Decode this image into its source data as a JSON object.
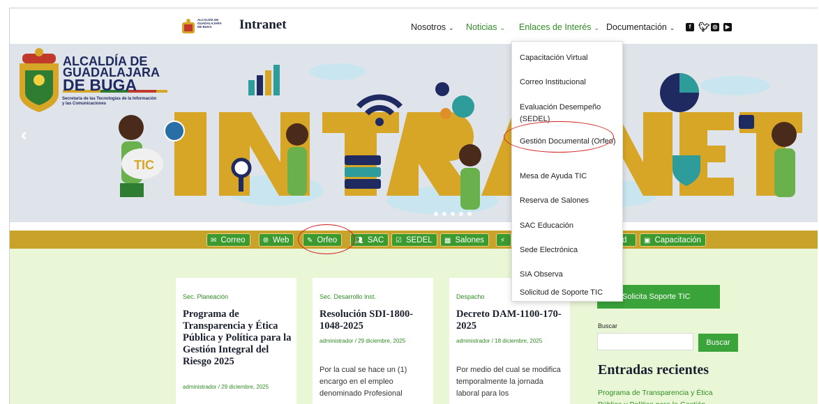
{
  "header": {
    "logo_text": "ALCALDÍA DE GUADALAJARA DE BUGA",
    "site_title": "Intranet",
    "nav": [
      {
        "label": "Nosotros",
        "chevron": "⌄"
      },
      {
        "label": "Noticias",
        "chevron": "⌄"
      },
      {
        "label": "Enlaces de Interés",
        "chevron": "⌄"
      },
      {
        "label": "Documentación",
        "chevron": "⌄"
      }
    ],
    "social_icons": [
      "facebook-icon",
      "twitter-icon",
      "instagram-icon",
      "youtube-icon"
    ],
    "colors": {
      "active_nav": "#2f8d23",
      "nav_text": "#222222"
    }
  },
  "hero": {
    "brand_line1": "ALCALDÍA DE",
    "brand_line2": "GUADALAJARA",
    "brand_line3": "DE BUGA",
    "brand_sub": "Secretaría de las Tecnologías de la Información y las Comunicaciones",
    "banner_word": "INTRANET",
    "sign_text": "TIC",
    "prev_arrow": "‹",
    "slider_dots": 5,
    "colors": {
      "letters": "#d8a627",
      "background": "#dfe4ea"
    }
  },
  "quick_links": [
    {
      "label": "Correo",
      "icon": "mail-icon"
    },
    {
      "label": "Web",
      "icon": "globe-icon"
    },
    {
      "label": "Orfeo",
      "icon": "document-edit-icon"
    },
    {
      "label": "SAC",
      "icon": "people-icon"
    },
    {
      "label": "SEDEL",
      "icon": "clipboard-check-icon"
    },
    {
      "label": "Salones",
      "icon": "building-icon"
    },
    {
      "label": "",
      "icon": "lightning-icon"
    },
    {
      "label": "d",
      "icon": ""
    },
    {
      "label": "Capacitación",
      "icon": "teacher-icon"
    }
  ],
  "dropdown": {
    "items": [
      "Capacitación Virtual",
      "Correo Institucional",
      "Evaluación Desempeño (SEDEL)",
      "Gestión Documental (Orfeo)",
      "Mesa de Ayuda TIC",
      "Reserva de Salones",
      "SAC Educación",
      "Sede Electrónica",
      "SIA Observa",
      "Solicitud de Soporte TIC"
    ]
  },
  "posts": [
    {
      "category": "Sec. Planeación",
      "title": "Programa de Transparencia y Ética Pública y Política para la Gestión Integral del Riesgo 2025",
      "meta": "administrador / 29 diciembre, 2025",
      "excerpt": ""
    },
    {
      "category": "Sec. Desarrollo Inst.",
      "title": "Resolución SDI-1800-1048-2025",
      "meta": "administrador / 29 diciembre, 2025",
      "excerpt": "Por la cual se hace un (1) encargo en el empleo denominado Profesional"
    },
    {
      "category": "Despacho",
      "title": "Decreto DAM-1100-170-2025",
      "meta": "administrador / 18 diciembre, 2025",
      "excerpt": "Por medio del cual se modifica temporalmente la jornada laboral para los"
    }
  ],
  "sidebar": {
    "support_button": "Solicita Soporte TIC",
    "search_label": "Buscar",
    "search_button": "Buscar",
    "search_value": "",
    "recent_title": "Entradas recientes",
    "recent_link": "Programa de Transparencia y Ética Pública y Política para la Gestión"
  },
  "colors": {
    "green": "#3a9a2e",
    "gold_bar": "#c9a229",
    "content_bg": "#eaf7d6",
    "annotation_red": "#d32020"
  }
}
